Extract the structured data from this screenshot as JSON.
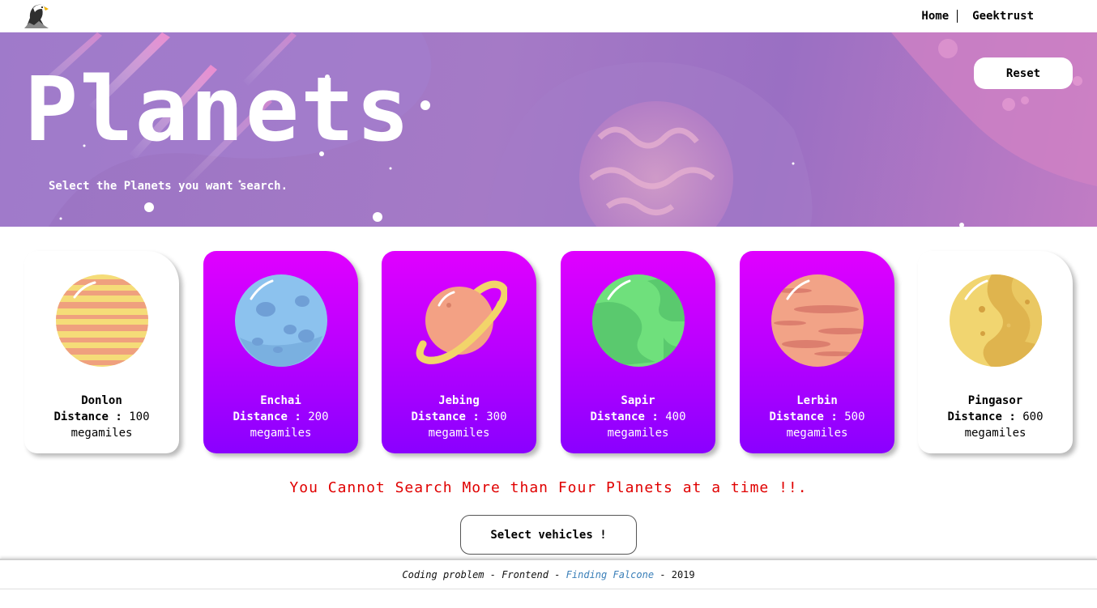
{
  "nav": {
    "home": "Home",
    "geektrust": "Geektrust"
  },
  "hero": {
    "title": "Planets",
    "subtitle": "Select the Planets you want search.",
    "reset_label": "Reset"
  },
  "cards": [
    {
      "name": "Donlon",
      "distance_label": "Distance :",
      "distance": "100",
      "unit": "megamiles",
      "selected": false,
      "planet_icon": "striped-yellow-planet-icon"
    },
    {
      "name": "Enchai",
      "distance_label": "Distance :",
      "distance": "200",
      "unit": "megamiles",
      "selected": true,
      "planet_icon": "blue-cratered-planet-icon"
    },
    {
      "name": "Jebing",
      "distance_label": "Distance :",
      "distance": "300",
      "unit": "megamiles",
      "selected": true,
      "planet_icon": "ringed-planet-icon"
    },
    {
      "name": "Sapir",
      "distance_label": "Distance :",
      "distance": "400",
      "unit": "megamiles",
      "selected": true,
      "planet_icon": "green-planet-icon"
    },
    {
      "name": "Lerbin",
      "distance_label": "Distance :",
      "distance": "500",
      "unit": "megamiles",
      "selected": true,
      "planet_icon": "red-striped-planet-icon"
    },
    {
      "name": "Pingasor",
      "distance_label": "Distance :",
      "distance": "600",
      "unit": "megamiles",
      "selected": false,
      "planet_icon": "gold-planet-icon"
    }
  ],
  "warning": "You Cannot Search More than Four Planets at a time !!.",
  "select_vehicles_label": "Select vehicles !",
  "footer": {
    "part1": "Coding problem - Frontend - ",
    "link": "Finding Falcone",
    "part2": " - 2019"
  },
  "colors": {
    "selected_card_top": "#e000ff",
    "selected_card_bottom": "#8a00ff",
    "warning": "#e00000",
    "link": "#3a7fb8"
  }
}
